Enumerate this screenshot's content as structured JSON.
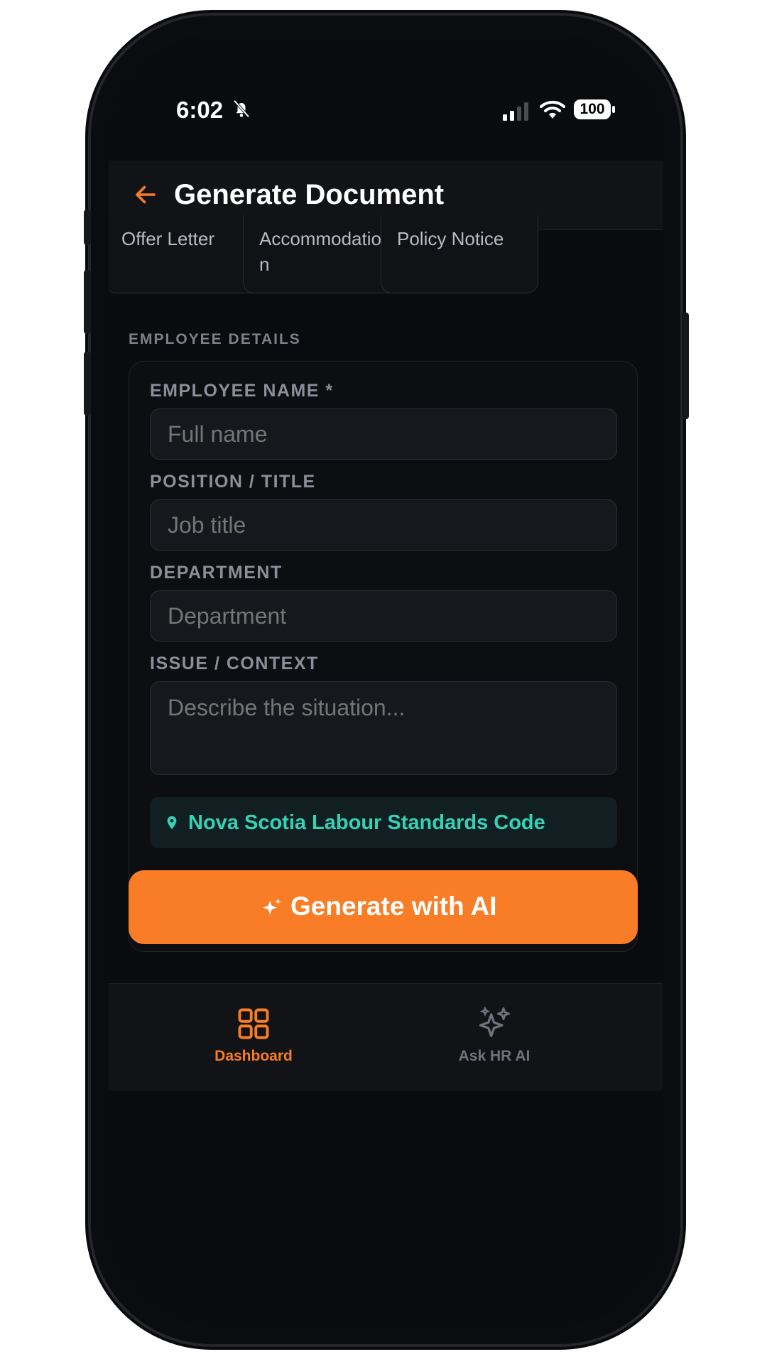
{
  "status_bar": {
    "time": "6:02",
    "battery": "100"
  },
  "header": {
    "title": "Generate Document"
  },
  "doc_types": [
    {
      "label": "Offer Letter"
    },
    {
      "label": "Accommodation"
    },
    {
      "label": "Policy Notice"
    }
  ],
  "section": {
    "label": "EMPLOYEE DETAILS"
  },
  "form": {
    "employee_name": {
      "label": "EMPLOYEE NAME *",
      "placeholder": "Full name"
    },
    "position": {
      "label": "POSITION / TITLE",
      "placeholder": "Job title"
    },
    "department": {
      "label": "DEPARTMENT",
      "placeholder": "Department"
    },
    "context": {
      "label": "ISSUE / CONTEXT",
      "placeholder": "Describe the situation..."
    }
  },
  "jurisdiction": {
    "text": "Nova Scotia Labour Standards Code"
  },
  "generate_button": {
    "label": "Generate with AI"
  },
  "nav": {
    "items": [
      {
        "label": "Dashboard",
        "active": true
      },
      {
        "label": "Ask HR AI",
        "active": false
      }
    ]
  },
  "colors": {
    "accent": "#f97d26",
    "teal": "#34d3b5",
    "background": "#0a0b0e"
  }
}
